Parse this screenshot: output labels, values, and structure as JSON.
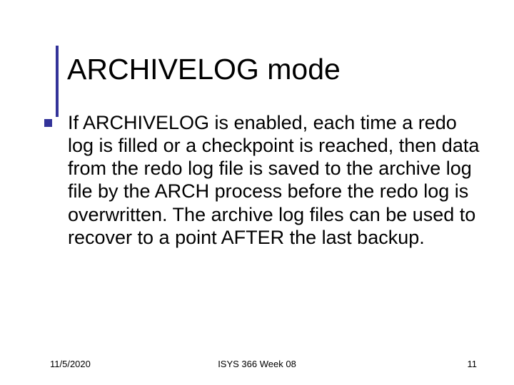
{
  "slide": {
    "title": "ARCHIVELOG mode",
    "body": "If ARCHIVELOG is enabled, each time a redo log is filled or a checkpoint is reached, then data from the redo log file is saved to the archive log file by the ARCH process before the redo log is overwritten.  The archive log files can be used to recover to a point AFTER the last backup."
  },
  "footer": {
    "date": "11/5/2020",
    "course": "ISYS 366  Week 08",
    "page": "11"
  }
}
